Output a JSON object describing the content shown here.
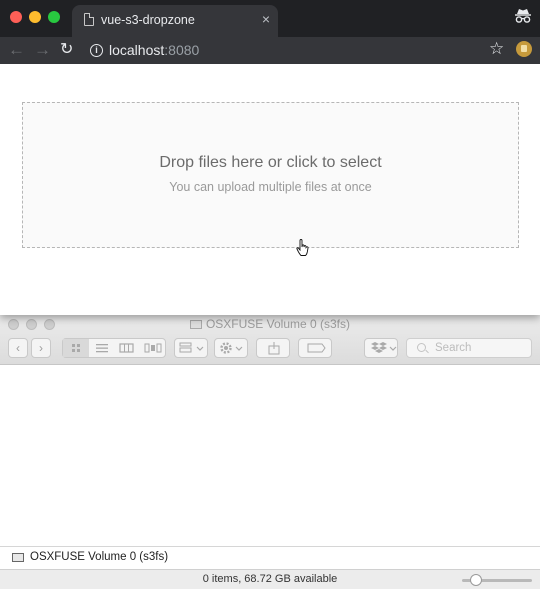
{
  "browser": {
    "tab_title": "vue-s3-dropzone",
    "tab_close": "×",
    "url_host": "localhost",
    "url_port": ":8080",
    "back": "←",
    "forward": "→",
    "reload": "↻",
    "bookmark": "☆",
    "info": "i"
  },
  "dropzone": {
    "title": "Drop files here or click to select",
    "subtitle": "You can upload multiple files at once"
  },
  "finder": {
    "window_title": "OSXFUSE Volume 0 (s3fs)",
    "search_placeholder": "Search",
    "path_label": "OSXFUSE Volume 0 (s3fs)",
    "status_text": "0 items, 68.72 GB available",
    "back": "‹",
    "forward": "›",
    "zoom_level": 0.2
  }
}
